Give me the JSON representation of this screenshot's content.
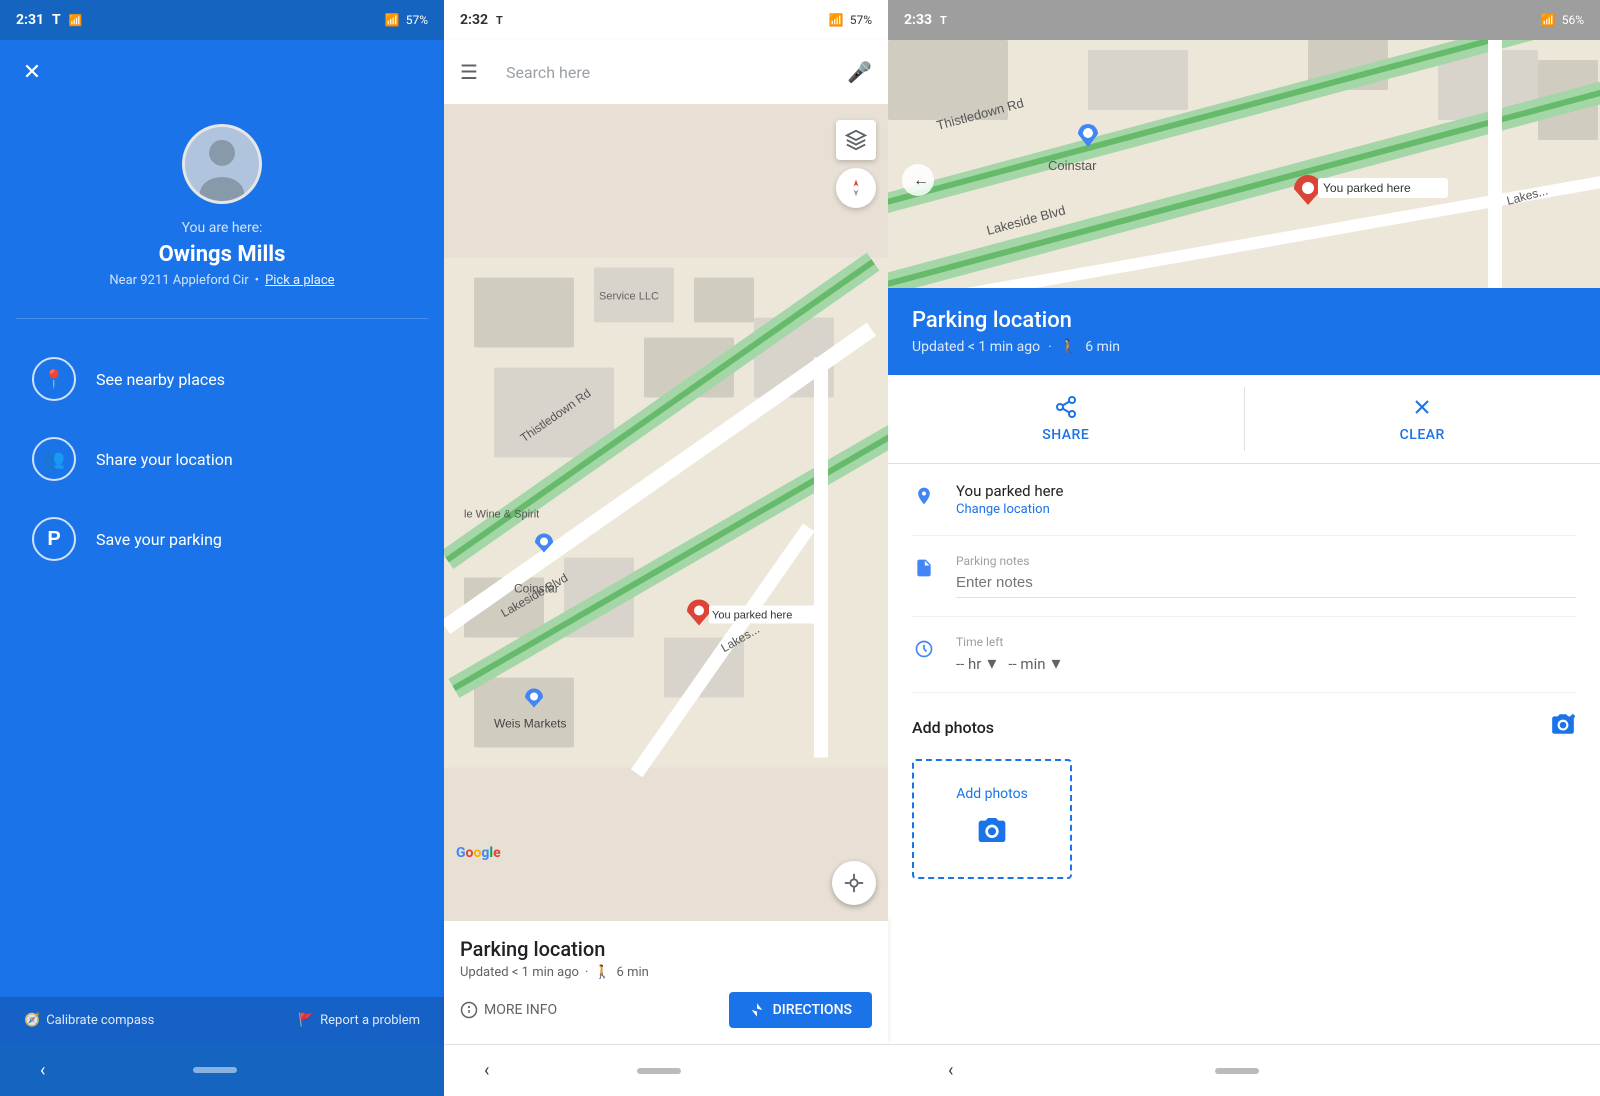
{
  "panel1": {
    "statusbar": {
      "time": "2:31",
      "battery": "57%"
    },
    "profile": {
      "you_are_here": "You are here:",
      "location": "Owings Mills",
      "near": "Near 9211 Appleford Cir",
      "pick_place": "Pick a place"
    },
    "menu": [
      {
        "id": "nearby",
        "label": "See nearby places",
        "icon": "📍"
      },
      {
        "id": "share",
        "label": "Share your location",
        "icon": "👥"
      },
      {
        "id": "parking",
        "label": "Save your parking",
        "icon": "P"
      }
    ],
    "footer": {
      "calibrate": "Calibrate compass",
      "report": "Report a problem"
    }
  },
  "panel2": {
    "statusbar": {
      "time": "2:32",
      "battery": "57%"
    },
    "search": {
      "placeholder": "Search here"
    },
    "map": {
      "labels": [
        "Thistledown Rd",
        "Lakeside Blvd",
        "Service LLC",
        "Coinstar",
        "Weis Markets",
        "le Wine & Spirit"
      ],
      "pin_label": "You parked here"
    },
    "bottom": {
      "title": "Parking location",
      "meta": "Updated < 1 min ago",
      "walk": "6 min",
      "more_info": "MORE INFO",
      "directions": "DIRECTIONS"
    }
  },
  "panel3": {
    "statusbar": {
      "time": "2:33",
      "battery": "56%"
    },
    "map": {
      "labels": [
        "Thistledown Rd",
        "Lakeside Blvd",
        "Coinstar"
      ],
      "pin_label": "You parked here"
    },
    "header": {
      "title": "Parking location",
      "meta": "Updated < 1 min ago",
      "walk": "6 min"
    },
    "actions": {
      "share": "SHARE",
      "clear": "CLEAR"
    },
    "parked": {
      "label": "You parked here",
      "change": "Change location"
    },
    "notes": {
      "label": "Parking notes",
      "placeholder": "Enter notes"
    },
    "time": {
      "label": "Time left",
      "hr": "-- hr",
      "min": "-- min"
    },
    "photos": {
      "title": "Add photos",
      "add_text": "Add photos"
    }
  }
}
